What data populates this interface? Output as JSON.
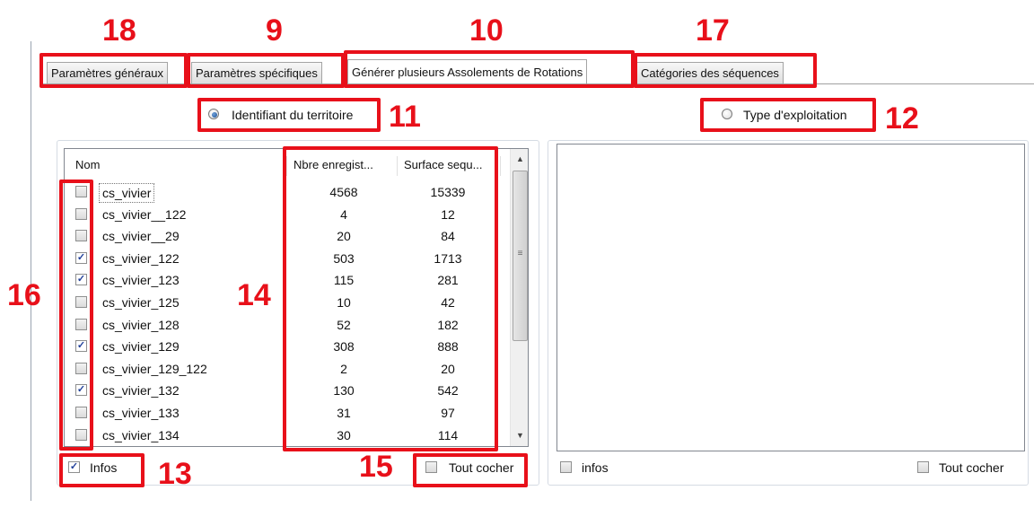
{
  "tabs": [
    {
      "label": "Paramètres généraux",
      "active": false
    },
    {
      "label": "Paramètres spécifiques",
      "active": false
    },
    {
      "label": "Générer plusieurs Assolements de Rotations",
      "active": true
    },
    {
      "label": "Catégories des séquences",
      "active": false
    }
  ],
  "radios": {
    "territory": {
      "label": "Identifiant du territoire",
      "selected": true
    },
    "exploitation": {
      "label": "Type d'exploitation",
      "selected": false
    }
  },
  "list": {
    "headers": [
      "Nom",
      "Nbre enregist...",
      "Surface sequ..."
    ],
    "rows": [
      {
        "name": "cs_vivier",
        "count": "4568",
        "surface": "15339",
        "checked": false
      },
      {
        "name": "cs_vivier__122",
        "count": "4",
        "surface": "12",
        "checked": false
      },
      {
        "name": "cs_vivier__29",
        "count": "20",
        "surface": "84",
        "checked": false
      },
      {
        "name": "cs_vivier_122",
        "count": "503",
        "surface": "1713",
        "checked": true
      },
      {
        "name": "cs_vivier_123",
        "count": "115",
        "surface": "281",
        "checked": true
      },
      {
        "name": "cs_vivier_125",
        "count": "10",
        "surface": "42",
        "checked": false
      },
      {
        "name": "cs_vivier_128",
        "count": "52",
        "surface": "182",
        "checked": false
      },
      {
        "name": "cs_vivier_129",
        "count": "308",
        "surface": "888",
        "checked": true
      },
      {
        "name": "cs_vivier_129_122",
        "count": "2",
        "surface": "20",
        "checked": false
      },
      {
        "name": "cs_vivier_132",
        "count": "130",
        "surface": "542",
        "checked": true
      },
      {
        "name": "cs_vivier_133",
        "count": "31",
        "surface": "97",
        "checked": false
      },
      {
        "name": "cs_vivier_134",
        "count": "30",
        "surface": "114",
        "checked": false
      }
    ]
  },
  "left_footer": {
    "infos_label": "Infos",
    "infos_checked": true,
    "tout_cocher_label": "Tout cocher",
    "tout_cocher_checked": false
  },
  "right_footer": {
    "infos_label": "infos",
    "infos_checked": false,
    "tout_cocher_label": "Tout cocher",
    "tout_cocher_checked": false
  },
  "annotations": {
    "n18": "18",
    "n9": "9",
    "n10": "10",
    "n17": "17",
    "n11": "11",
    "n12": "12",
    "n16": "16",
    "n14": "14",
    "n13": "13",
    "n15": "15"
  },
  "colors": {
    "annotation_red": "#e8101a",
    "check_blue": "#21409a"
  }
}
